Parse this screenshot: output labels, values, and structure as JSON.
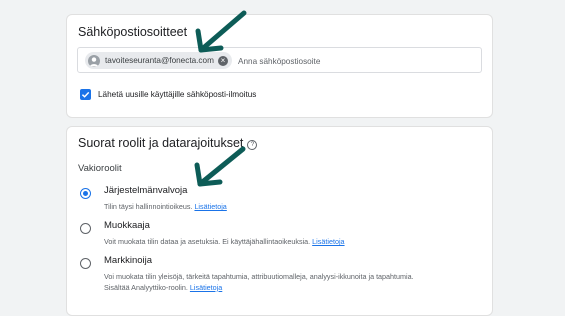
{
  "email_section": {
    "title": "Sähköpostiosoitteet",
    "chip_email": "tavoiteseuranta@fonecta.com",
    "input_placeholder": "Anna sähköpostiosoite",
    "notify_label": "Lähetä uusille käyttäjille sähköposti-ilmoitus",
    "notify_checked": true
  },
  "roles_section": {
    "title": "Suorat roolit ja datarajoitukset",
    "standard_roles_label": "Vakioroolit",
    "selected_role": "Järjestelmänvalvoja",
    "roles": [
      {
        "name": "Järjestelmänvalvoja",
        "desc": "Tilin täysi hallinnointioikeus.",
        "link": "Lisätietoja"
      },
      {
        "name": "Muokkaaja",
        "desc": "Voit muokata tilin dataa ja asetuksia. Ei käyttäjähallintaoikeuksia.",
        "link": "Lisätietoja"
      },
      {
        "name": "Markkinoija",
        "desc": "Voi muokata tilin yleisöjä, tärkeitä tapahtumia, attribuutiomalleja, analyysi-ikkunoita ja tapahtumia. Sisältää Analyyttiko-roolin.",
        "link": "Lisätietoja"
      }
    ]
  },
  "colors": {
    "accent": "#1a73e8",
    "arrow": "#0d5c57"
  },
  "icons": [
    "avatar-icon",
    "close-icon",
    "check-icon",
    "help-icon",
    "arrow-annotation"
  ]
}
